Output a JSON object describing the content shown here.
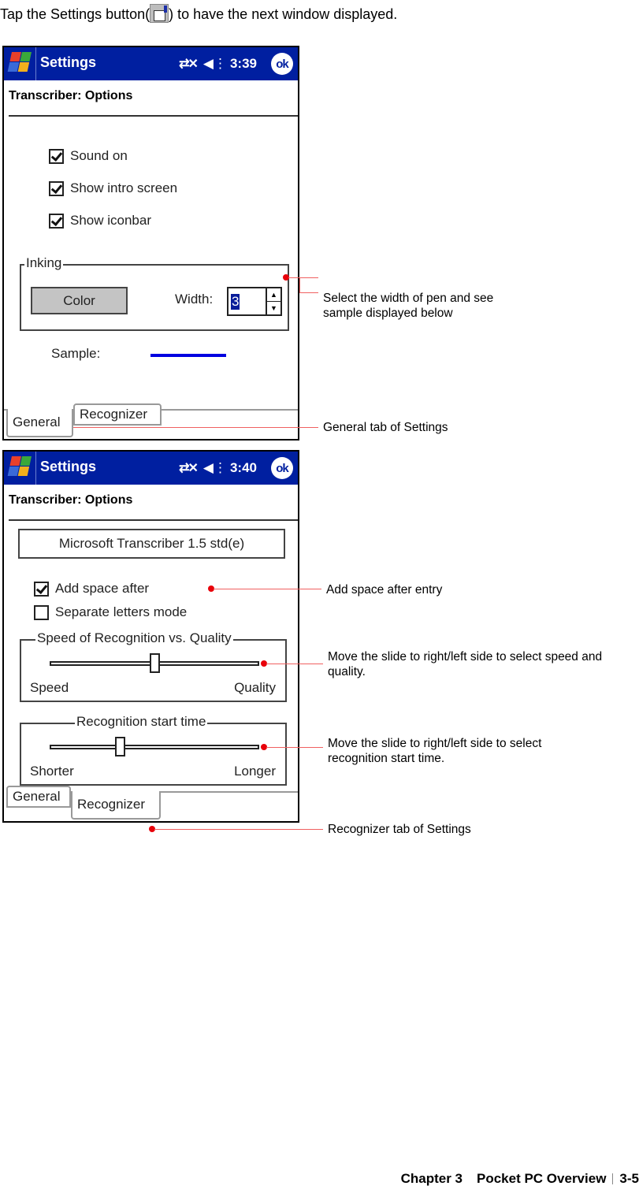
{
  "intro": {
    "before": "Tap the Settings button(",
    "after": ") to have the next window displayed.",
    "icon": "settings-icon"
  },
  "screens": [
    {
      "titlebar": {
        "app_title": "Settings",
        "time": "3:39",
        "ok_label": "ok",
        "icons": [
          "windows-start-icon",
          "connectivity-icon",
          "speaker-icon"
        ]
      },
      "page_header": "Transcriber: Options",
      "checkboxes": [
        {
          "label": "Sound on",
          "checked": true
        },
        {
          "label": "Show intro screen",
          "checked": true
        },
        {
          "label": "Show iconbar",
          "checked": true
        }
      ],
      "inking": {
        "group_label": "Inking",
        "color_button": "Color",
        "width_label": "Width:",
        "width_value": "3"
      },
      "sample_label": "Sample:",
      "sample_color": "#0000e0",
      "tabs": [
        {
          "label": "General",
          "active": true
        },
        {
          "label": "Recognizer",
          "active": false
        }
      ]
    },
    {
      "titlebar": {
        "app_title": "Settings",
        "time": "3:40",
        "ok_label": "ok",
        "icons": [
          "windows-start-icon",
          "connectivity-icon",
          "speaker-icon"
        ]
      },
      "page_header": "Transcriber: Options",
      "version_box": "Microsoft Transcriber 1.5 std(e)",
      "checkboxes": [
        {
          "label": "Add space after",
          "checked": true
        },
        {
          "label": "Separate letters mode",
          "checked": false
        }
      ],
      "speed_quality": {
        "group_label": "Speed of Recognition vs. Quality",
        "min_label": "Speed",
        "max_label": "Quality",
        "value_fraction": 0.5
      },
      "start_time": {
        "group_label": "Recognition start time",
        "min_label": "Shorter",
        "max_label": "Longer",
        "value_fraction": 0.33
      },
      "tabs": [
        {
          "label": "General",
          "active": false
        },
        {
          "label": "Recognizer",
          "active": true
        }
      ]
    }
  ],
  "callouts": {
    "width": "Select the width of pen and see sample displayed below",
    "general_tab": "General tab of Settings",
    "add_space": "Add space after entry",
    "speed_quality": "Move the slide to right/left side to select speed and quality.",
    "start_time": "Move the slide to right/left side to select recognition start time.",
    "recognizer_tab": "Recognizer tab of Settings"
  },
  "colors": {
    "titlebar": "#001fa0",
    "callout_line": "#f06060",
    "callout_dot": "#e8000a"
  },
  "footer": {
    "chapter": "Chapter 3",
    "title": "Pocket PC Overview",
    "page": "3-5"
  }
}
